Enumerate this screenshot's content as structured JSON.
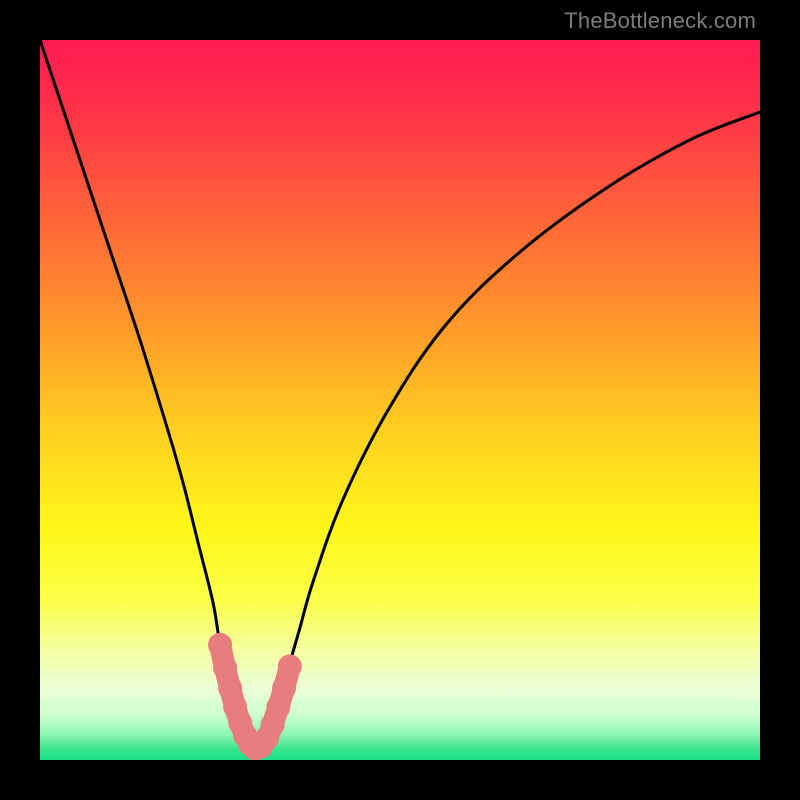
{
  "watermark": "TheBottleneck.com",
  "colors": {
    "frame": "#000000",
    "curve": "#000000",
    "marker_fill": "#e77e7d",
    "marker_stroke": "#c96a6a"
  },
  "gradient_stops": [
    {
      "offset": 0.0,
      "color": "#ff1a52"
    },
    {
      "offset": 0.1,
      "color": "#ff3348"
    },
    {
      "offset": 0.25,
      "color": "#ff6638"
    },
    {
      "offset": 0.4,
      "color": "#ff9a2a"
    },
    {
      "offset": 0.55,
      "color": "#ffd21f"
    },
    {
      "offset": 0.68,
      "color": "#fff81a"
    },
    {
      "offset": 0.78,
      "color": "#fbff4a"
    },
    {
      "offset": 0.86,
      "color": "#f2ffb0"
    },
    {
      "offset": 0.905,
      "color": "#e9ffd8"
    },
    {
      "offset": 0.94,
      "color": "#c9ffd0"
    },
    {
      "offset": 0.965,
      "color": "#8cf7b2"
    },
    {
      "offset": 0.985,
      "color": "#3be48f"
    },
    {
      "offset": 1.0,
      "color": "#19e084"
    }
  ],
  "chart_data": {
    "type": "line",
    "title": "",
    "xlabel": "",
    "ylabel": "",
    "xlim": [
      0,
      100
    ],
    "ylim": [
      0,
      100
    ],
    "series": [
      {
        "name": "bottleneck-curve",
        "x": [
          0,
          6,
          10,
          14,
          18,
          20,
          22,
          24,
          25,
          26,
          27,
          28,
          29,
          30,
          31,
          32,
          33,
          34,
          36,
          38,
          42,
          48,
          56,
          66,
          78,
          90,
          100
        ],
        "y": [
          100,
          82,
          70,
          58,
          45,
          38,
          30,
          22,
          16,
          11,
          7,
          4,
          2,
          1.5,
          2,
          4,
          7,
          11,
          18,
          25,
          36,
          48,
          60,
          70,
          79,
          86,
          90
        ]
      }
    ],
    "markers": {
      "name": "highlight-near-minimum",
      "x": [
        25.0,
        25.7,
        26.4,
        27.1,
        27.8,
        28.5,
        29.2,
        29.9,
        30.7,
        31.5,
        32.3,
        33.1,
        33.9,
        34.7
      ],
      "y": [
        16.0,
        12.8,
        10.0,
        7.4,
        5.2,
        3.4,
        2.2,
        1.6,
        1.9,
        3.0,
        4.9,
        7.3,
        10.0,
        13.0
      ]
    },
    "minimum_x": 29.5
  }
}
